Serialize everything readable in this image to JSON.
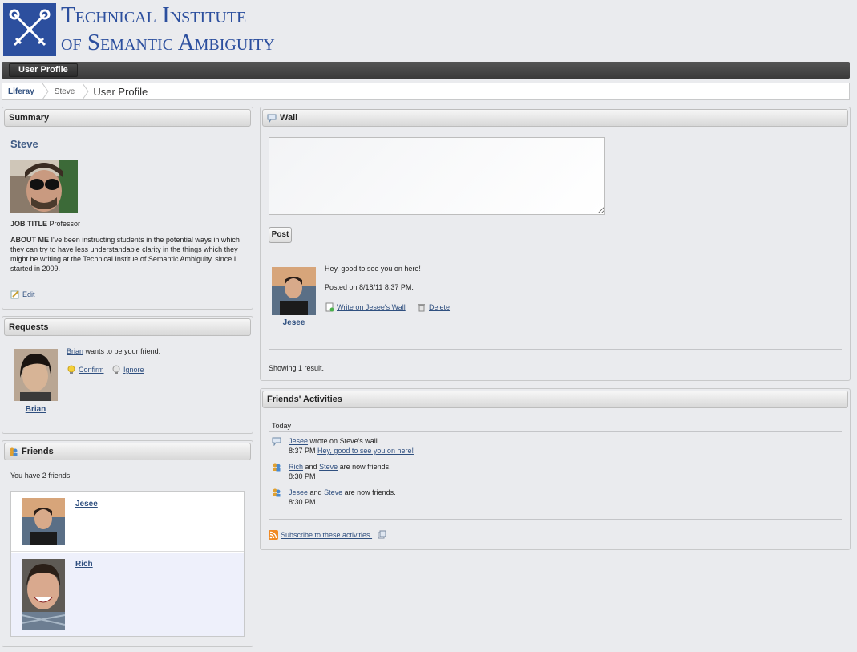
{
  "site": {
    "title_line1": "Technical Institute",
    "title_line2": "of Semantic Ambiguity"
  },
  "nav": {
    "tab_label": "User Profile"
  },
  "breadcrumb": {
    "items": [
      "Liferay",
      "Steve",
      "User Profile"
    ]
  },
  "summary": {
    "title": "Summary",
    "name": "Steve",
    "job_title_label": "JOB TITLE",
    "job_title_value": "Professor",
    "about_label": "ABOUT ME",
    "about_text": "I've been instructing students in the potential ways in which they can try to have less understandable clarity in the things which they might be writing at the Technical Institue of Semantic Ambiguity, since I started in 2009.",
    "edit_label": "Edit"
  },
  "requests": {
    "title": "Requests",
    "from_name": "Brian",
    "message": "wants to be your friend.",
    "confirm_label": "Confirm",
    "ignore_label": "Ignore",
    "caption": "Brian"
  },
  "friends": {
    "title": "Friends",
    "count_text": "You have 2 friends.",
    "list": [
      {
        "name": "Jesee"
      },
      {
        "name": "Rich"
      }
    ]
  },
  "wall": {
    "title": "Wall",
    "post_label": "Post",
    "entry": {
      "author": "Jesee",
      "message": "Hey, good to see you on here!",
      "posted": "Posted on 8/18/11 8:37 PM.",
      "write_label": "Write on Jesee's Wall",
      "delete_label": "Delete"
    },
    "results_text": "Showing 1 result."
  },
  "activities": {
    "title": "Friends' Activities",
    "day_label": "Today",
    "items": [
      {
        "actor": "Jesee",
        "text": "wrote on Steve's wall.",
        "time": "8:37 PM",
        "link": "Hey, good to see you on here!"
      },
      {
        "actor": "Rich",
        "and": "and",
        "target": "Steve",
        "text": "are now friends.",
        "time": "8:30 PM"
      },
      {
        "actor": "Jesee",
        "and": "and",
        "target": "Steve",
        "text": "are now friends.",
        "time": "8:30 PM"
      }
    ],
    "subscribe_label": "Subscribe to these activities."
  },
  "colors": {
    "brand_blue": "#2c4f9e",
    "link": "#2f4f7f",
    "nav_dark": "#3a3a3a"
  }
}
